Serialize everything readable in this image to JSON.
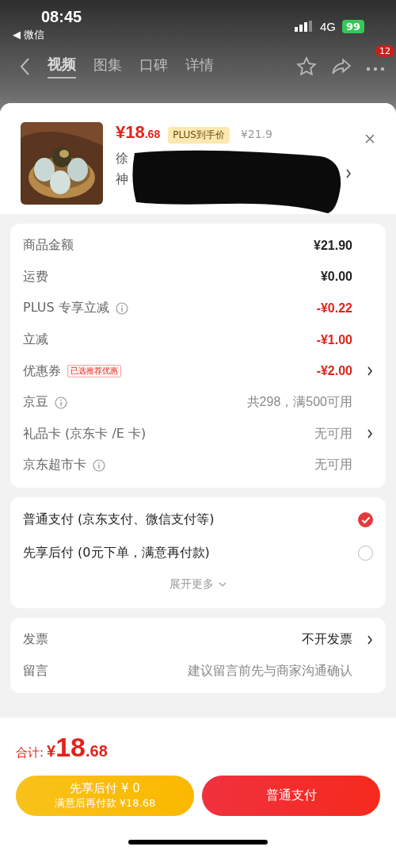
{
  "status_bar": {
    "time": "08:45",
    "back_app": "◀ 微信",
    "network": "4G",
    "battery": "99"
  },
  "nav": {
    "tabs": [
      {
        "label": "视频",
        "selected": true
      },
      {
        "label": "图集",
        "selected": false
      },
      {
        "label": "口碑",
        "selected": false
      },
      {
        "label": "详情",
        "selected": false
      }
    ],
    "badge": "12"
  },
  "product": {
    "price_int": "¥18",
    "price_dec": ".68",
    "price_tag": "PLUS到手价",
    "original_price": "¥21.9",
    "title_lines": [
      "徐",
      "神"
    ]
  },
  "price_rows": [
    {
      "label": "商品金额",
      "info": false,
      "value": "¥21.90",
      "kind": "strong",
      "chevron": false
    },
    {
      "label": "运费",
      "info": false,
      "value": "¥0.00",
      "kind": "strong",
      "chevron": false
    },
    {
      "label": "PLUS 专享立减",
      "info": true,
      "value": "-¥0.22",
      "kind": "discount",
      "chevron": false
    },
    {
      "label": "立减",
      "info": false,
      "value": "-¥1.00",
      "kind": "discount",
      "chevron": false
    },
    {
      "label": "优惠券",
      "info": false,
      "tag": "已选推荐优惠",
      "value": "-¥2.00",
      "kind": "discount",
      "chevron": true
    },
    {
      "label": "京豆",
      "info": true,
      "value": "共298，满500可用",
      "kind": "muted",
      "chevron": false
    },
    {
      "label": "礼品卡 (京东卡 /E 卡)",
      "info": false,
      "value": "无可用",
      "kind": "muted",
      "chevron": true
    },
    {
      "label": "京东超市卡",
      "info": true,
      "value": "无可用",
      "kind": "muted",
      "chevron": false
    }
  ],
  "payment_options": [
    {
      "label": "普通支付 (京东支付、微信支付等)",
      "selected": true
    },
    {
      "label": "先享后付 (0元下单，满意再付款)",
      "selected": false
    }
  ],
  "expand_more": "展开更多",
  "extra_rows": [
    {
      "label": "发票",
      "value": "不开发票",
      "kind": "strong",
      "chevron": true
    },
    {
      "label": "留言",
      "value": "建议留言前先与商家沟通确认",
      "kind": "muted",
      "chevron": false
    }
  ],
  "total": {
    "label": "合计:",
    "currency": "¥",
    "int": "18",
    "dec": ".68"
  },
  "buttons": [
    {
      "kind": "later",
      "line1": "先享后付 ¥ 0",
      "line2": "满意后再付款 ¥18.68"
    },
    {
      "kind": "pay",
      "line1": "普通支付"
    }
  ]
}
